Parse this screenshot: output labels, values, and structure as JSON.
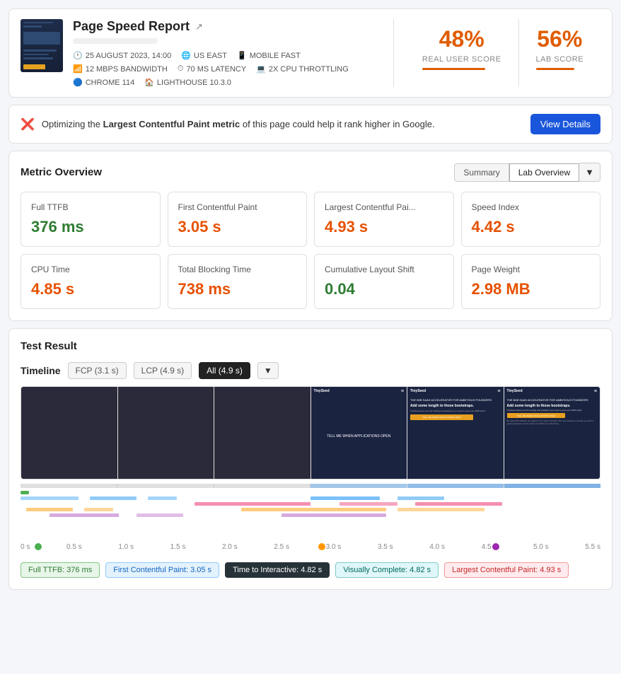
{
  "header": {
    "title": "Page Speed Report",
    "date": "25 AUGUST 2023, 14:00",
    "location": "US EAST",
    "device": "MOBILE FAST",
    "bandwidth": "12 MBPS BANDWIDTH",
    "latency": "70 MS LATENCY",
    "cpu": "2X CPU THROTTLING",
    "browser": "CHROME 114",
    "lighthouse": "LIGHTHOUSE 10.3.0"
  },
  "scores": {
    "real_user": {
      "value": "48%",
      "label": "REAL USER SCORE"
    },
    "lab": {
      "value": "56%",
      "label": "LAB SCORE"
    }
  },
  "alert": {
    "text_prefix": "Optimizing the",
    "metric_name": "Largest Contentful Paint metric",
    "text_suffix": "of this page could help it rank higher in Google.",
    "button_label": "View Details"
  },
  "metrics_section": {
    "title": "Metric Overview",
    "toggle_summary": "Summary",
    "toggle_lab": "Lab Overview",
    "metrics": [
      {
        "name": "Full TTFB",
        "value": "376 ms",
        "color": "green"
      },
      {
        "name": "First Contentful Paint",
        "value": "3.05 s",
        "color": "orange"
      },
      {
        "name": "Largest Contentful Pai...",
        "value": "4.93 s",
        "color": "orange"
      },
      {
        "name": "Speed Index",
        "value": "4.42 s",
        "color": "orange"
      },
      {
        "name": "CPU Time",
        "value": "4.85 s",
        "color": "orange"
      },
      {
        "name": "Total Blocking Time",
        "value": "738 ms",
        "color": "orange"
      },
      {
        "name": "Cumulative Layout Shift",
        "value": "0.04",
        "color": "green"
      },
      {
        "name": "Page Weight",
        "value": "2.98 MB",
        "color": "orange"
      }
    ]
  },
  "test_result": {
    "title": "Test Result",
    "timeline_label": "Timeline",
    "btn_fcp": "FCP (3.1 s)",
    "btn_lcp": "LCP (4.9 s)",
    "btn_all": "All (4.9 s)"
  },
  "timeline_labels": [
    {
      "text": "Full TTFB: 376 ms",
      "style": "green"
    },
    {
      "text": "First Contentful Paint: 3.05 s",
      "style": "blue"
    },
    {
      "text": "Time to Interactive: 4.82 s",
      "style": "dark"
    },
    {
      "text": "Visually Complete: 4.82 s",
      "style": "teal"
    },
    {
      "text": "Largest Contentful Paint: 4.93 s",
      "style": "red"
    }
  ],
  "ruler_ticks": [
    "0 s",
    "0.5 s",
    "1.0 s",
    "1.5 s",
    "2.0 s",
    "2.5 s",
    "3.0 s",
    "3.5 s",
    "4.0 s",
    "4.5 s",
    "5.0 s",
    "5.5 s"
  ]
}
